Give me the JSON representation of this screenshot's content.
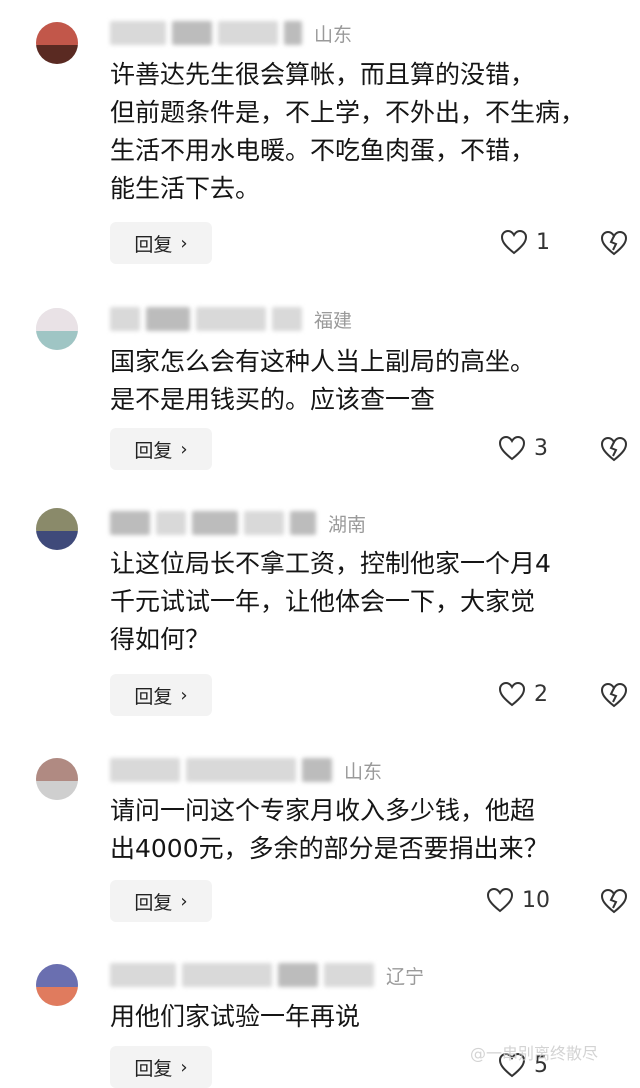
{
  "comments": [
    {
      "location": "山东",
      "text": "许善达先生很会算帐，而且算的没错，\n但前题条件是，不上学，不外出，不生病，\n生活不用水电暖。不吃鱼肉蛋，不错，\n能生活下去。",
      "reply_label": "回复",
      "likes": "1",
      "avatar_colors": [
        "#c2574a",
        "#5a2a22"
      ]
    },
    {
      "location": "福建",
      "text": "国家怎么会有这种人当上副局的高坐。\n是不是用钱买的。应该查一查",
      "reply_label": "回复",
      "likes": "3",
      "avatar_colors": [
        "#e9e2e6",
        "#9fc5c4"
      ]
    },
    {
      "location": "湖南",
      "text": "让这位局长不拿工资，控制他家一个月4\n千元试试一年，让他体会一下，大家觉\n得如何？",
      "reply_label": "回复",
      "likes": "2",
      "avatar_colors": [
        "#8a8a6a",
        "#3f4a7a"
      ]
    },
    {
      "location": "山东",
      "text": "请问一问这个专家月收入多少钱，他超\n出4000元，多余的部分是否要捐出来？",
      "reply_label": "回复",
      "likes": "10",
      "avatar_colors": [
        "#b08a82",
        "#cfcfcf"
      ]
    },
    {
      "location": "辽宁",
      "text": "用他们家试验一年再说",
      "reply_label": "回复",
      "likes": "5",
      "avatar_colors": [
        "#6a6fb0",
        "#e07b5e"
      ]
    }
  ],
  "watermark": "@一串别离终散尽"
}
